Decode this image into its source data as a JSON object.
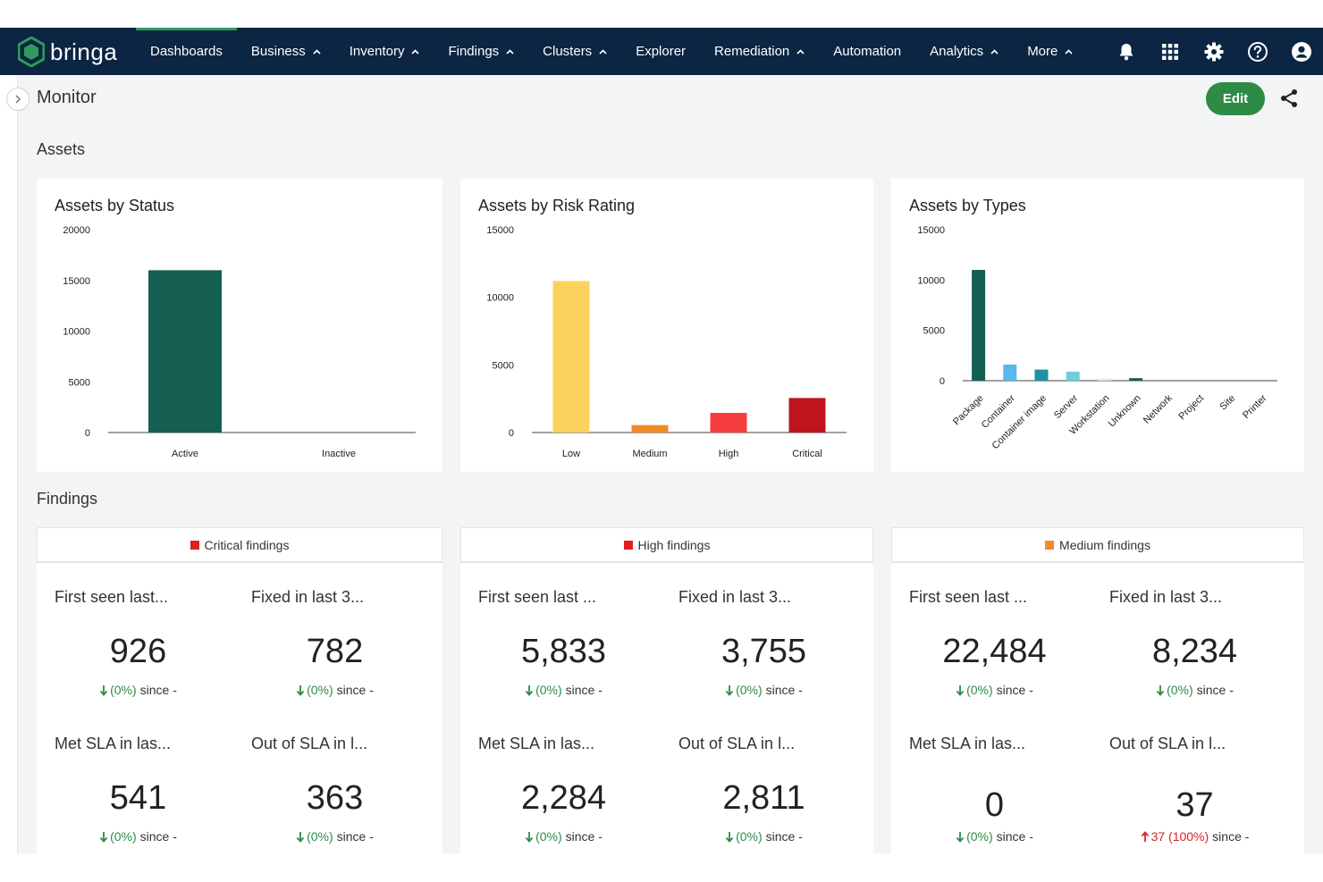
{
  "app": {
    "brand": "bringa",
    "nav": [
      {
        "label": "Dashboards",
        "has_menu": false,
        "active": true
      },
      {
        "label": "Business",
        "has_menu": true
      },
      {
        "label": "Inventory",
        "has_menu": true
      },
      {
        "label": "Findings",
        "has_menu": true
      },
      {
        "label": "Clusters",
        "has_menu": true
      },
      {
        "label": "Explorer",
        "has_menu": false
      },
      {
        "label": "Remediation",
        "has_menu": true
      },
      {
        "label": "Automation",
        "has_menu": false
      },
      {
        "label": "Analytics",
        "has_menu": true
      },
      {
        "label": "More",
        "has_menu": true
      }
    ],
    "nav_icons": [
      "bell-icon",
      "apps-grid-icon",
      "settings-gear-icon",
      "help-icon",
      "user-account-icon"
    ],
    "colors": {
      "topbar": "#0b2542",
      "accent": "#2e8b46"
    }
  },
  "page": {
    "title": "Monitor",
    "edit_label": "Edit"
  },
  "sections": {
    "assets": "Assets",
    "findings": "Findings"
  },
  "chart_data": [
    {
      "type": "bar",
      "title": "Assets by Status",
      "categories": [
        "Active",
        "Inactive"
      ],
      "values": [
        16000,
        0
      ],
      "colors": [
        "#155e52",
        "#155e52"
      ],
      "ylim": [
        0,
        20000
      ],
      "yticks": [
        0,
        5000,
        10000,
        15000,
        20000
      ]
    },
    {
      "type": "bar",
      "title": "Assets by Risk Rating",
      "categories": [
        "Low",
        "Medium",
        "High",
        "Critical"
      ],
      "values": [
        11200,
        550,
        1450,
        2550
      ],
      "colors": [
        "#fcd25c",
        "#f28c28",
        "#f63d3d",
        "#c0141f"
      ],
      "ylim": [
        0,
        15000
      ],
      "yticks": [
        0,
        5000,
        10000,
        15000
      ]
    },
    {
      "type": "bar",
      "title": "Assets by Types",
      "categories": [
        "Package",
        "Container",
        "Container image",
        "Server",
        "Workstation",
        "Unknown",
        "Network",
        "Project",
        "Site",
        "Printer"
      ],
      "values": [
        11000,
        1600,
        1100,
        900,
        200,
        250,
        0,
        0,
        0,
        0
      ],
      "colors": [
        "#155e52",
        "#5ab8ea",
        "#1f8fa3",
        "#6fcdd8",
        "#cfe8f5",
        "#155e52",
        "#155e52",
        "#155e52",
        "#155e52",
        "#155e52"
      ],
      "ylim": [
        0,
        15000
      ],
      "yticks": [
        0,
        5000,
        10000,
        15000
      ]
    }
  ],
  "findings": [
    {
      "title": "Critical findings",
      "color": "#e01f1f",
      "metrics": [
        {
          "label": "First seen last...",
          "value": "926",
          "arrow": "down",
          "delta": "(0%)",
          "since": "since -"
        },
        {
          "label": "Fixed in last 3...",
          "value": "782",
          "arrow": "down",
          "delta": "(0%)",
          "since": "since -"
        },
        {
          "label": "Met SLA in las...",
          "value": "541",
          "arrow": "down",
          "delta": "(0%)",
          "since": "since -"
        },
        {
          "label": "Out of SLA in l...",
          "value": "363",
          "arrow": "down",
          "delta": "(0%)",
          "since": "since -"
        }
      ]
    },
    {
      "title": "High findings",
      "color": "#e01f1f",
      "metrics": [
        {
          "label": "First seen last ...",
          "value": "5,833",
          "arrow": "down",
          "delta": "(0%)",
          "since": "since -"
        },
        {
          "label": "Fixed in last 3...",
          "value": "3,755",
          "arrow": "down",
          "delta": "(0%)",
          "since": "since -"
        },
        {
          "label": "Met SLA in las...",
          "value": "2,284",
          "arrow": "down",
          "delta": "(0%)",
          "since": "since -"
        },
        {
          "label": "Out of SLA in l...",
          "value": "2,811",
          "arrow": "down",
          "delta": "(0%)",
          "since": "since -"
        }
      ]
    },
    {
      "title": "Medium findings",
      "color": "#f28c28",
      "metrics": [
        {
          "label": "First seen last ...",
          "value": "22,484",
          "arrow": "down",
          "delta": "(0%)",
          "since": "since -"
        },
        {
          "label": "Fixed in last 3...",
          "value": "8,234",
          "arrow": "down",
          "delta": "(0%)",
          "since": "since -"
        },
        {
          "label": "Met SLA in las...",
          "value": "0",
          "arrow": "down",
          "delta": "(0%)",
          "since": "since -"
        },
        {
          "label": "Out of SLA in l...",
          "value": "37",
          "arrow": "up",
          "delta": "37 (100%)",
          "since": "since -"
        }
      ]
    }
  ]
}
